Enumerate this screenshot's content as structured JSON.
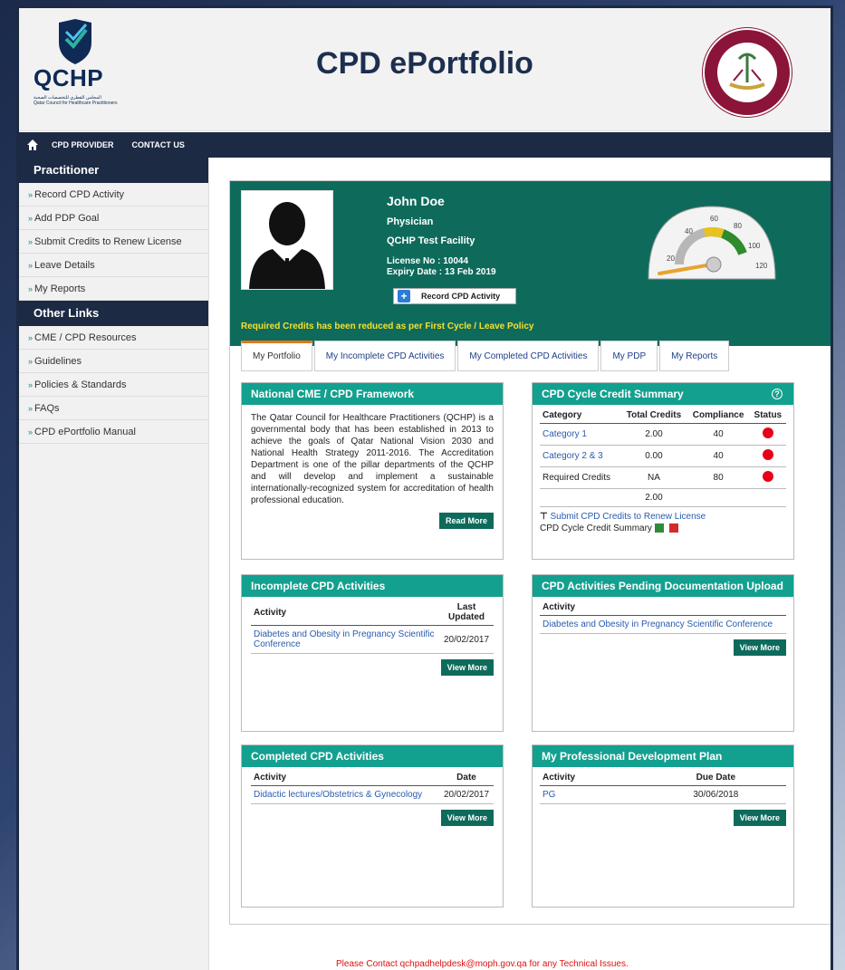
{
  "header": {
    "brand": "QCHP",
    "logo_sub_ar": "المجلس القطري للتخصصات الصحية",
    "logo_sub_en": "Qatar Council for Healthcare Practitioners",
    "title": "CPD ePortfolio",
    "seal_top": "State of Qatar",
    "seal_bottom": "MINISTRY OF PUBLIC HEALTH"
  },
  "nav": {
    "items": [
      "CPD PROVIDER",
      "CONTACT US"
    ]
  },
  "sidebar": {
    "practitioner_heading": "Practitioner",
    "practitioner_items": [
      "Record CPD Activity",
      "Add PDP Goal",
      "Submit Credits to Renew License",
      "Leave Details",
      "My Reports"
    ],
    "other_heading": "Other Links",
    "other_items": [
      "CME / CPD Resources",
      "Guidelines",
      "Policies & Standards",
      "FAQs",
      "CPD ePortfolio Manual"
    ]
  },
  "profile": {
    "name": "John Doe",
    "role": "Physician",
    "facility": "QCHP Test Facility",
    "license": "License No : 10044",
    "expiry": "Expiry Date : 13 Feb 2019",
    "record_button": "Record CPD Activity",
    "notice": "Required Credits has been reduced as per First Cycle / Leave Policy",
    "gauge": {
      "ticks": [
        "20",
        "40",
        "60",
        "80",
        "100",
        "120"
      ]
    }
  },
  "tabs": [
    "My Portfolio",
    "My Incomplete CPD Activities",
    "My Completed CPD Activities",
    "My PDP",
    "My Reports"
  ],
  "framework": {
    "title": "National CME / CPD Framework",
    "body": "The Qatar Council for Healthcare Practitioners (QCHP) is a governmental body that has been established in 2013 to achieve the goals of Qatar National Vision 2030 and National Health Strategy 2011-2016. The Accreditation Department is one of the pillar departments of the QCHP and will develop and implement a sustainable internationally-recognized system for accreditation of health professional education.",
    "button": "Read More"
  },
  "credit_summary": {
    "title": "CPD Cycle Credit Summary",
    "headers": [
      "Category",
      "Total Credits",
      "Compliance",
      "Status"
    ],
    "rows": [
      [
        "Category 1",
        "2.00",
        "40"
      ],
      [
        "Category 2 & 3",
        "0.00",
        "40"
      ],
      [
        "Required Credits",
        "NA",
        "80"
      ]
    ],
    "total": "2.00",
    "submit_link": "Submit CPD Credits to Renew License",
    "summary_label": "CPD Cycle Credit Summary"
  },
  "incomplete": {
    "title": "Incomplete CPD Activities",
    "headers": [
      "Activity",
      "Last Updated"
    ],
    "rows": [
      [
        "Diabetes and Obesity in Pregnancy Scientific Conference",
        "20/02/2017"
      ]
    ],
    "button": "View More"
  },
  "pending": {
    "title": "CPD Activities Pending Documentation Upload",
    "headers": [
      "Activity"
    ],
    "rows": [
      [
        "Diabetes and Obesity in Pregnancy Scientific Conference"
      ]
    ],
    "button": "View More"
  },
  "completed": {
    "title": "Completed CPD Activities",
    "headers": [
      "Activity",
      "Date"
    ],
    "rows": [
      [
        "Didactic lectures/Obstetrics & Gynecology",
        "20/02/2017"
      ]
    ],
    "button": "View More"
  },
  "pdp": {
    "title": "My Professional Development Plan",
    "headers": [
      "Activity",
      "Due Date"
    ],
    "rows": [
      [
        "PG",
        "30/06/2018"
      ]
    ],
    "button": "View More"
  },
  "footer": "Please Contact qchpadhelpdesk@moph.gov.qa for any Technical Issues."
}
